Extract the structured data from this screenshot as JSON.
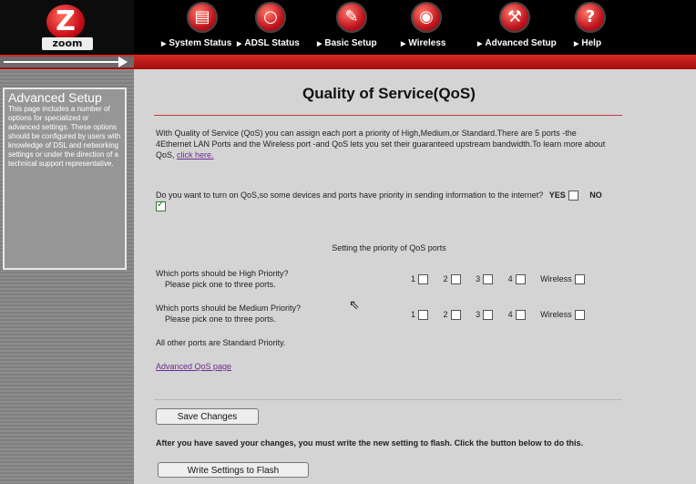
{
  "logo": {
    "text": "zoom"
  },
  "nav": {
    "items": [
      {
        "label": "System Status",
        "icon": "folder-icon"
      },
      {
        "label": "ADSL Status",
        "icon": "magnifier-icon"
      },
      {
        "label": "Basic Setup",
        "icon": "plug-icon"
      },
      {
        "label": "Wireless",
        "icon": "antenna-icon"
      },
      {
        "label": "Advanced Setup",
        "icon": "wrench-icon"
      },
      {
        "label": "Help",
        "icon": "question-icon"
      }
    ]
  },
  "sidebar": {
    "title": "Advanced Setup",
    "description": "This page includes a number of options for specialized or advanced settings. These options should be configured by users with knowledge of DSL and networking settings or under the direction of a technical support representative."
  },
  "main": {
    "title": "Quality of Service(QoS)",
    "intro": "With Quality of Service (QoS) you can assign each port a priority of High,Medium,or Standard.There are 5 ports -the 4Ethernet LAN Ports and the Wireless port -and QoS lets you set their guaranteed upstream bandwidth.To learn more about QoS,",
    "intro_link": "click here.",
    "question": "Do you want to turn on QoS,so some devices and ports have priority in sending information to the internet?",
    "yes_label": "YES",
    "no_label": "NO",
    "qos_enabled": false,
    "priority_heading": "Setting the priority of QoS ports",
    "high": {
      "question": "Which ports should be High Priority?",
      "hint": "Please pick one to three ports.",
      "ports": [
        "1",
        "2",
        "3",
        "4",
        "Wireless"
      ]
    },
    "medium": {
      "question": "Which ports should be Medium Priority?",
      "hint": "Please pick one to three ports.",
      "ports": [
        "1",
        "2",
        "3",
        "4",
        "Wireless"
      ]
    },
    "standard_note": "All other ports are Standard Priority.",
    "advanced_link": "Advanced QoS page",
    "save_button": "Save Changes",
    "flash_note": "After you have saved your changes, you must write the new setting to flash. Click the button below to do this.",
    "flash_button": "Write Settings to Flash"
  }
}
